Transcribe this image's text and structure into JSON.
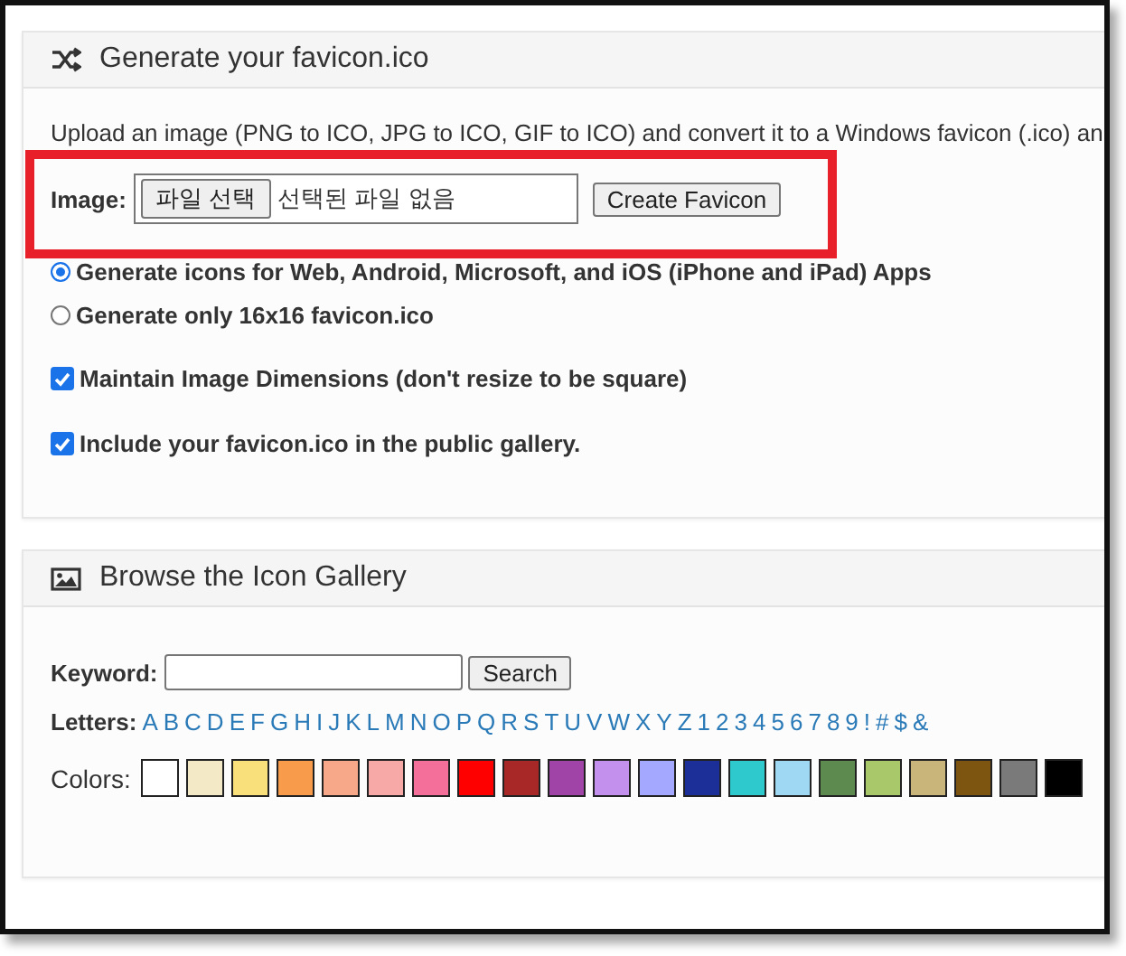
{
  "generate_panel": {
    "title": "Generate your favicon.ico",
    "description": "Upload an image (PNG to ICO, JPG to ICO, GIF to ICO) and convert it to a Windows favicon (.ico) an",
    "image_label": "Image:",
    "file_button": "파일 선택",
    "file_status": "선택된 파일 없음",
    "create_button": "Create Favicon",
    "radios": [
      {
        "label": "Generate icons for Web, Android, Microsoft, and iOS (iPhone and iPad) Apps",
        "selected": true
      },
      {
        "label": "Generate only 16x16 favicon.ico",
        "selected": false
      }
    ],
    "checkboxes": [
      {
        "label": "Maintain Image Dimensions (don't resize to be square)",
        "checked": true
      },
      {
        "label": "Include your favicon.ico in the public gallery.",
        "checked": true
      }
    ]
  },
  "gallery_panel": {
    "title": "Browse the Icon Gallery",
    "keyword_label": "Keyword:",
    "search_button": "Search",
    "letters_label": "Letters:",
    "letters": [
      "A",
      "B",
      "C",
      "D",
      "E",
      "F",
      "G",
      "H",
      "I",
      "J",
      "K",
      "L",
      "M",
      "N",
      "O",
      "P",
      "Q",
      "R",
      "S",
      "T",
      "U",
      "V",
      "W",
      "X",
      "Y",
      "Z",
      "1",
      "2",
      "3",
      "4",
      "5",
      "6",
      "7",
      "8",
      "9",
      "!",
      "#",
      "$",
      "&"
    ],
    "colors_label": "Colors:",
    "colors": [
      {
        "color": "#ffffff"
      },
      {
        "color": "#f3e9c6"
      },
      {
        "color": "#f9e07a"
      },
      {
        "color": "#f89c4c"
      },
      {
        "color": "#f7a889"
      },
      {
        "color": "#f7a9a8"
      },
      {
        "color": "#f56f9b"
      },
      {
        "color": "#ff0000"
      },
      {
        "color": "#a82828"
      },
      {
        "color": "#a044a8"
      },
      {
        "color": "#c390ee"
      },
      {
        "color": "#a4a8ff"
      },
      {
        "color": "#1c2f99"
      },
      {
        "color": "#2ec9cc"
      },
      {
        "color": "#9ed8f3"
      },
      {
        "color": "#5d8a4e"
      },
      {
        "color": "#a8c86a"
      },
      {
        "color": "#c9b47a"
      },
      {
        "color": "#7d5510"
      },
      {
        "color": "#7a7a7a"
      },
      {
        "color": "#000000"
      }
    ]
  }
}
